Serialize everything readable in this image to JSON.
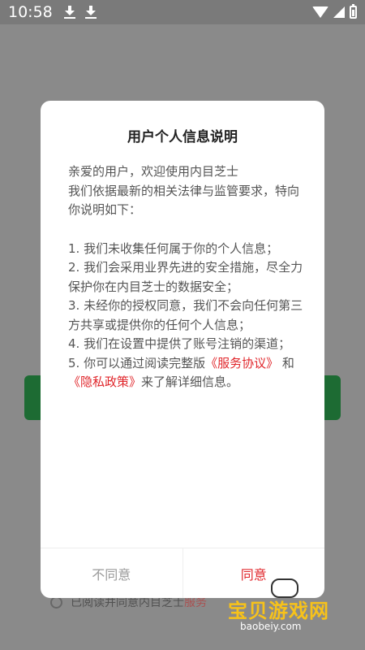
{
  "status_bar": {
    "time": "10:58"
  },
  "dialog": {
    "title": "用户个人信息说明",
    "intro": [
      "亲爱的用户，欢迎使用内目芝士",
      "我们依据最新的相关法律与监管要求，特向你说明如下："
    ],
    "items": [
      "1. 我们未收集任何属于你的个人信息；",
      "2. 我们会采用业界先进的安全措施，尽全力保护你在内目芝士的数据安全；",
      "3. 未经你的授权同意，我们不会向任何第三方共享或提供你的任何个人信息；",
      "4. 我们在设置中提供了账号注销的渠道；"
    ],
    "item5": {
      "prefix": "5. 你可以通过阅读完整版",
      "service_link": "《服务协议》",
      "and": " 和 ",
      "privacy_link": "《隐私政策》",
      "suffix": "来了解详细信息。"
    },
    "disagree_label": "不同意",
    "agree_label": "同意"
  },
  "background": {
    "agree_text": "已阅读并同意内目芝士",
    "agree_link": "服务"
  },
  "watermark": {
    "text": "宝贝游戏网",
    "url": "baobeiy.com"
  },
  "colors": {
    "accent": "#e0262b",
    "green": "#1d6b33"
  }
}
